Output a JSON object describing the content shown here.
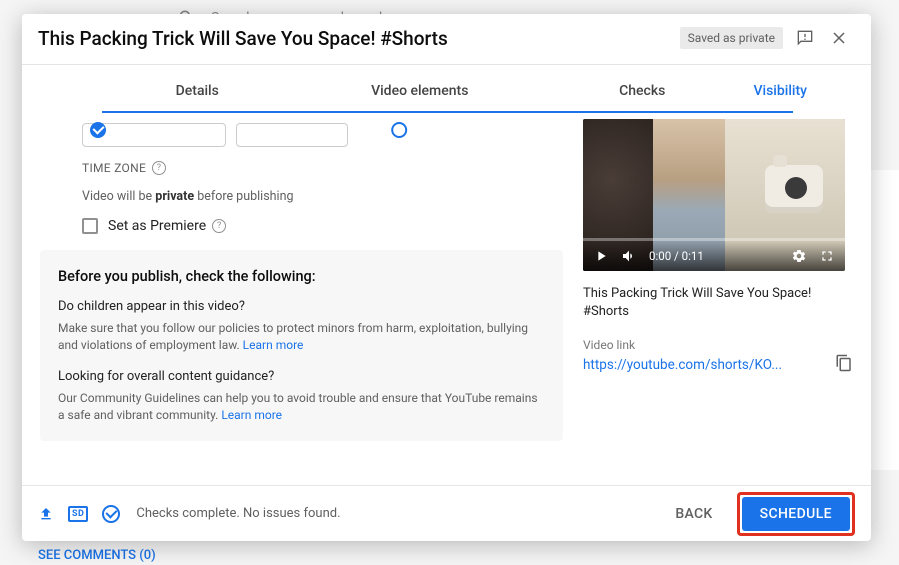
{
  "background": {
    "search_placeholder": "Search across your channel",
    "see_comments": "SEE COMMENTS (0)"
  },
  "modal": {
    "title": "This Packing Trick Will Save You Space! #Shorts",
    "saved_badge": "Saved as private",
    "stepper": [
      "Details",
      "Video elements",
      "Checks",
      "Visibility"
    ],
    "timezone_label": "TIME ZONE",
    "privacy_note_before": "Video will be ",
    "privacy_note_bold": "private",
    "privacy_note_after": " before publishing",
    "premiere_label": "Set as Premiere",
    "info": {
      "heading": "Before you publish, check the following:",
      "q1": "Do children appear in this video?",
      "p1": "Make sure that you follow our policies to protect minors from harm, exploitation, bullying and violations of employment law. ",
      "learn1": "Learn more",
      "q2": "Looking for overall content guidance?",
      "p2": "Our Community Guidelines can help you to avoid trouble and ensure that YouTube remains a safe and vibrant community. ",
      "learn2": "Learn more"
    },
    "preview": {
      "time": "0:00 / 0:11",
      "video_title": "This Packing Trick Will Save You Space! #Shorts",
      "link_label": "Video link",
      "link": "https://youtube.com/shorts/KO..."
    },
    "footer": {
      "sd": "SD",
      "status": "Checks complete. No issues found.",
      "back": "BACK",
      "schedule": "SCHEDULE"
    }
  }
}
